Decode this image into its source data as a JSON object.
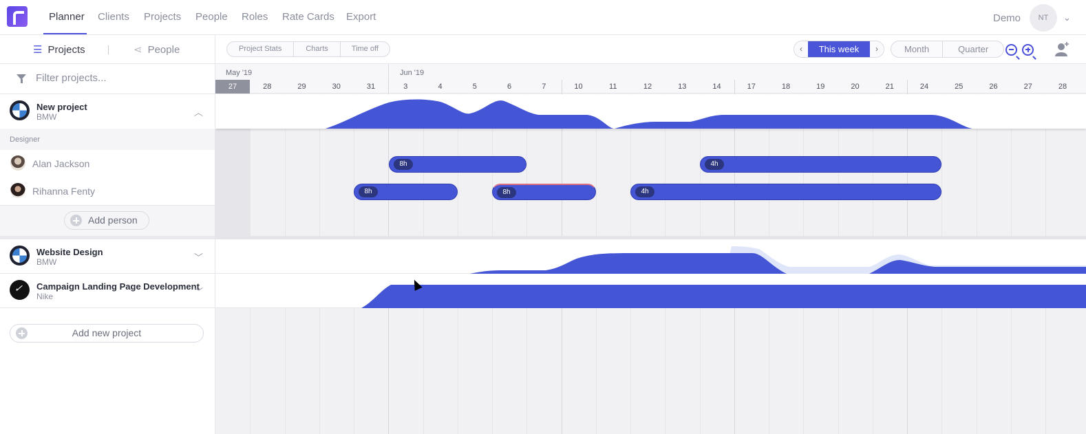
{
  "topnav": {
    "items": [
      "Planner",
      "Clients",
      "Projects",
      "People",
      "Roles",
      "Rate Cards",
      "Export"
    ],
    "account_label": "Demo",
    "avatar_initials": "NT"
  },
  "toolbar": {
    "view_projects": "Projects",
    "view_people": "People",
    "pills": [
      "Project Stats",
      "Charts",
      "Time off"
    ],
    "this_week": "This week",
    "month": "Month",
    "quarter": "Quarter"
  },
  "filter": {
    "placeholder": "Filter projects..."
  },
  "projects": [
    {
      "name": "New project",
      "client": "BMW",
      "expanded": true,
      "logo": "bmw-logo"
    },
    {
      "name": "Website Design",
      "client": "BMW",
      "expanded": false,
      "logo": "bmw-logo"
    },
    {
      "name": "Campaign Landing Page Development",
      "client": "Nike",
      "expanded": false,
      "logo": "nike-logo"
    }
  ],
  "role": "Designer",
  "people": [
    {
      "name": "Alan Jackson"
    },
    {
      "name": "Rihanna Fenty"
    }
  ],
  "add_person": "Add person",
  "add_project": "Add new project",
  "timeline": {
    "months": [
      {
        "label": "May '19"
      },
      {
        "label": "Jun '19"
      }
    ],
    "days": [
      "27",
      "28",
      "29",
      "30",
      "31",
      "3",
      "4",
      "5",
      "6",
      "7",
      "10",
      "11",
      "12",
      "13",
      "14",
      "17",
      "18",
      "19",
      "20",
      "21",
      "24",
      "25",
      "26",
      "27",
      "28"
    ],
    "today_index": 0,
    "assignments": {
      "alan": [
        {
          "label": "8h"
        },
        {
          "label": "4h"
        }
      ],
      "rihanna": [
        {
          "label": "8h"
        },
        {
          "label": "8h"
        },
        {
          "label": "4h"
        }
      ]
    }
  },
  "colors": {
    "accent": "#4455d6",
    "badge": "#2c367f",
    "overtime": "#e07080"
  }
}
